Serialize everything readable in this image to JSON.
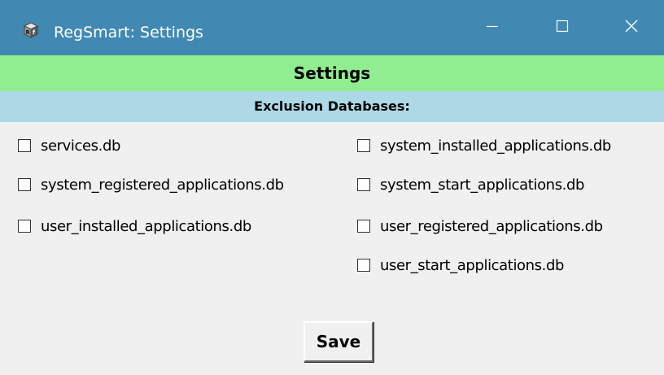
{
  "window": {
    "title": "RegSmart: Settings",
    "titlebar_color": "#4189b2",
    "icon": "regsmart-app-icon",
    "controls": [
      "minimize-icon",
      "maximize-icon",
      "close-icon"
    ]
  },
  "header": {
    "title": "Settings",
    "background": "#90ee90"
  },
  "section": {
    "title": "Exclusion Databases:",
    "background": "#add8e6"
  },
  "checkboxes": [
    {
      "label": "services.db",
      "checked": false
    },
    {
      "label": "system_installed_applications.db",
      "checked": false
    },
    {
      "label": "system_registered_applications.db",
      "checked": false
    },
    {
      "label": "system_start_applications.db",
      "checked": false
    },
    {
      "label": "user_installed_applications.db",
      "checked": false
    },
    {
      "label": "user_registered_applications.db",
      "checked": false
    },
    {
      "label": "user_start_applications.db",
      "checked": false
    }
  ],
  "actions": {
    "save_label": "Save"
  }
}
